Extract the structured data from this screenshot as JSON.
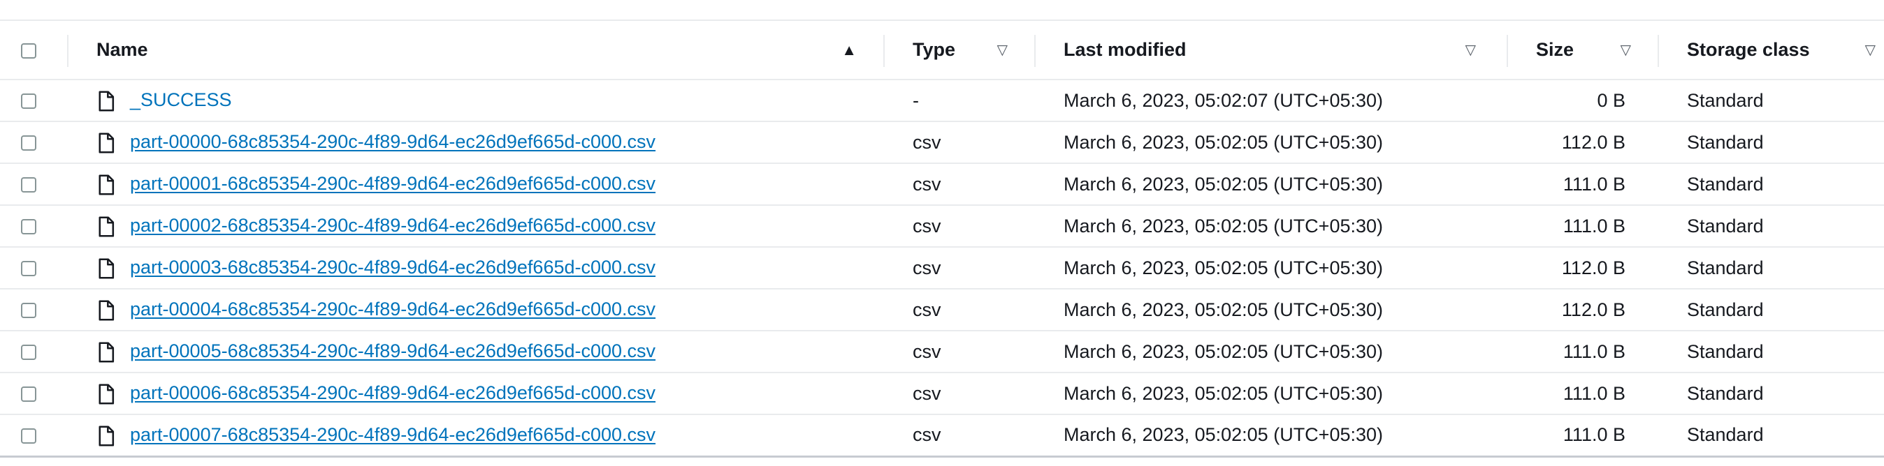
{
  "table": {
    "columns": {
      "name": "Name",
      "type": "Type",
      "last_modified": "Last modified",
      "size": "Size",
      "storage_class": "Storage class"
    },
    "sort": {
      "column": "name",
      "direction": "ascending"
    },
    "rows": [
      {
        "name": "_SUCCESS",
        "type": "-",
        "last_modified": "March 6, 2023, 05:02:07 (UTC+05:30)",
        "size": "0 B",
        "storage_class": "Standard"
      },
      {
        "name": "part-00000-68c85354-290c-4f89-9d64-ec26d9ef665d-c000.csv",
        "type": "csv",
        "last_modified": "March 6, 2023, 05:02:05 (UTC+05:30)",
        "size": "112.0 B",
        "storage_class": "Standard"
      },
      {
        "name": "part-00001-68c85354-290c-4f89-9d64-ec26d9ef665d-c000.csv",
        "type": "csv",
        "last_modified": "March 6, 2023, 05:02:05 (UTC+05:30)",
        "size": "111.0 B",
        "storage_class": "Standard"
      },
      {
        "name": "part-00002-68c85354-290c-4f89-9d64-ec26d9ef665d-c000.csv",
        "type": "csv",
        "last_modified": "March 6, 2023, 05:02:05 (UTC+05:30)",
        "size": "111.0 B",
        "storage_class": "Standard"
      },
      {
        "name": "part-00003-68c85354-290c-4f89-9d64-ec26d9ef665d-c000.csv",
        "type": "csv",
        "last_modified": "March 6, 2023, 05:02:05 (UTC+05:30)",
        "size": "112.0 B",
        "storage_class": "Standard"
      },
      {
        "name": "part-00004-68c85354-290c-4f89-9d64-ec26d9ef665d-c000.csv",
        "type": "csv",
        "last_modified": "March 6, 2023, 05:02:05 (UTC+05:30)",
        "size": "112.0 B",
        "storage_class": "Standard"
      },
      {
        "name": "part-00005-68c85354-290c-4f89-9d64-ec26d9ef665d-c000.csv",
        "type": "csv",
        "last_modified": "March 6, 2023, 05:02:05 (UTC+05:30)",
        "size": "111.0 B",
        "storage_class": "Standard"
      },
      {
        "name": "part-00006-68c85354-290c-4f89-9d64-ec26d9ef665d-c000.csv",
        "type": "csv",
        "last_modified": "March 6, 2023, 05:02:05 (UTC+05:30)",
        "size": "111.0 B",
        "storage_class": "Standard"
      },
      {
        "name": "part-00007-68c85354-290c-4f89-9d64-ec26d9ef665d-c000.csv",
        "type": "csv",
        "last_modified": "March 6, 2023, 05:02:05 (UTC+05:30)",
        "size": "111.0 B",
        "storage_class": "Standard"
      }
    ]
  },
  "icons": {
    "row_icon": "file-icon",
    "sort_active": "caret-up-filled-icon",
    "sort_inactive": "caret-down-outline-icon"
  },
  "colors": {
    "link": "#0073bb",
    "text": "#16191f",
    "border": "#e9ebed",
    "checkbox_border": "#879596"
  }
}
